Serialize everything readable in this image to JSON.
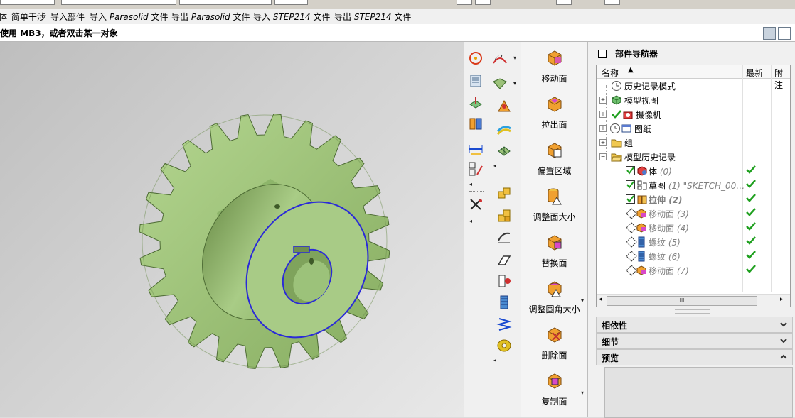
{
  "menubar": {
    "items": [
      "体",
      "简单干涉",
      "导入部件",
      "导入",
      "Parasolid",
      "文件",
      "导出",
      "Parasolid",
      "文件",
      "导入",
      "STEP214",
      "文件",
      "导出",
      "STEP214",
      "文件"
    ]
  },
  "cue": {
    "text": "使用 MB3，或者双击某一对象"
  },
  "toolbar": {
    "commands": [
      {
        "label": "移动面",
        "icon": "move-face-icon"
      },
      {
        "label": "拉出面",
        "icon": "pull-face-icon"
      },
      {
        "label": "偏置区域",
        "icon": "offset-region-icon"
      },
      {
        "label": "调整面大小",
        "icon": "resize-face-icon"
      },
      {
        "label": "替换面",
        "icon": "replace-face-icon"
      },
      {
        "label": "调整圆角大小",
        "icon": "resize-blend-icon"
      },
      {
        "label": "删除面",
        "icon": "delete-face-icon"
      },
      {
        "label": "复制面",
        "icon": "copy-face-icon"
      }
    ]
  },
  "navigator": {
    "title": "部件导航器",
    "columns": {
      "name": "名称",
      "latest": "最新",
      "attach": "附注"
    },
    "rows": [
      {
        "label": "历史记录模式",
        "note": ""
      },
      {
        "label": "模型视图",
        "note": ""
      },
      {
        "label": "摄像机",
        "note": ""
      },
      {
        "label": "图纸",
        "note": ""
      },
      {
        "label": "组",
        "note": ""
      },
      {
        "label": "模型历史记录",
        "note": ""
      },
      {
        "label": "体",
        "note": "(0)"
      },
      {
        "label": "草图",
        "note": "(1) \"SKETCH_00…"
      },
      {
        "label": "拉伸",
        "note": "(2)"
      },
      {
        "label": "移动面",
        "note": "(3)"
      },
      {
        "label": "移动面",
        "note": "(4)"
      },
      {
        "label": "螺纹",
        "note": "(5)"
      },
      {
        "label": "螺纹",
        "note": "(6)"
      },
      {
        "label": "移动面",
        "note": "(7)"
      }
    ],
    "scroll_grip": "III",
    "sections": {
      "dependencies": "相依性",
      "details": "细节",
      "preview": "预览"
    }
  },
  "colors": {
    "part_green": "#9ec27a",
    "selection_blue": "#2a2ad8",
    "check_green": "#1fa01f"
  }
}
